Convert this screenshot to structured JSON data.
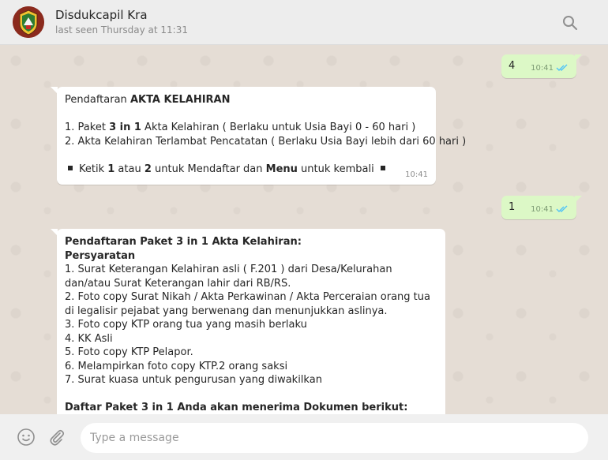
{
  "header": {
    "contact_name": "Disdukcapil Kra",
    "last_seen": "last seen Thursday at 11:31",
    "avatar_icon": "regency-emblem-icon",
    "search_icon": "search-icon"
  },
  "messages": {
    "m1": {
      "text": "4",
      "time": "10:41",
      "status": "read"
    },
    "m2": {
      "title_prefix": "Pendaftaran ",
      "title_bold": "AKTA KELAHIRAN",
      "item1_a": "1. Paket ",
      "item1_b": "3 in 1",
      "item1_c": " Akta Kelahiran ( Berlaku untuk Usia Bayi 0 - 60 hari )",
      "item2": "2. Akta Kelahiran Terlambat Pencatatan ( Berlaku Usia Bayi lebih dari 60 hari )",
      "footer_a": "Ketik ",
      "footer_b": "1",
      "footer_c": " atau ",
      "footer_d": "2",
      "footer_e": " untuk Mendaftar dan ",
      "footer_f": "Menu",
      "footer_g": " untuk kembali",
      "time": "10:41"
    },
    "m3": {
      "text": "1",
      "time": "10:41",
      "status": "read"
    },
    "m4": {
      "title": "Pendaftaran Paket 3 in 1 Akta Kelahiran:",
      "subtitle": "Persyaratan",
      "req1": "1. Surat Keterangan Kelahiran asli ( F.201 ) dari Desa/Kelurahan dan/atau Surat Keterangan lahir dari RB/RS.",
      "req2": "2. Foto copy Surat Nikah / Akta Perkawinan / Akta Perceraian orang tua di legalisir pejabat yang berwenang dan menunjukkan aslinya.",
      "req3": "3. Foto copy KTP orang tua yang masih berlaku",
      "req4": "4. KK Asli",
      "req5": "5. Foto copy KTP Pelapor.",
      "req6": "6. Melampirkan foto copy KTP.2 orang saksi",
      "req7": "7. Surat kuasa untuk pengurusan yang diwakilkan",
      "next_heading": "Daftar Paket 3 in 1 Anda akan menerima Dokumen berikut:"
    }
  },
  "composer": {
    "placeholder": "Type a message",
    "emoji_icon": "emoji-icon",
    "attach_icon": "paperclip-icon"
  },
  "colors": {
    "outgoing_bubble": "#dcf8c6",
    "incoming_bubble": "#ffffff",
    "read_ticks": "#4fc3f7",
    "chat_background": "#e5ddd5"
  }
}
